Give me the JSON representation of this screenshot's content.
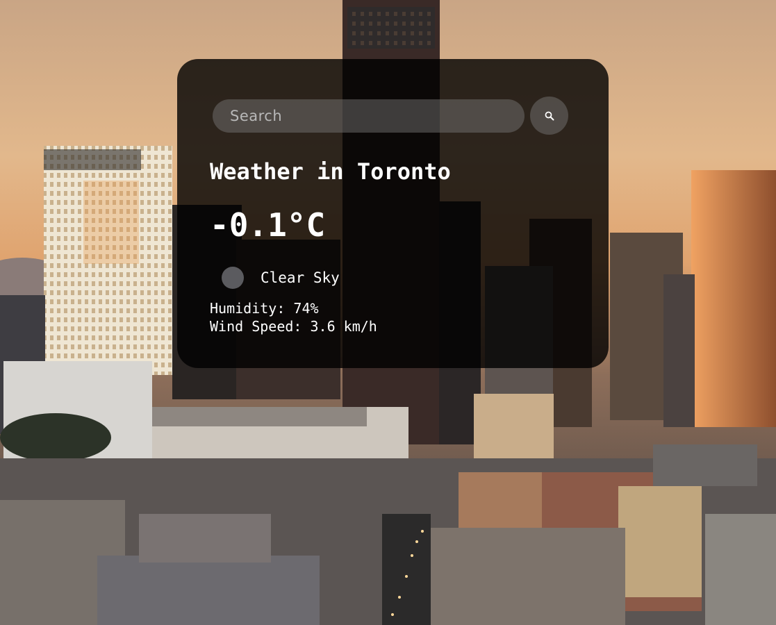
{
  "search": {
    "placeholder": "Search",
    "value": ""
  },
  "weather": {
    "city_heading": "Weather in Toronto",
    "temperature": "-0.1°C",
    "description": "Clear Sky",
    "humidity": "Humidity: 74%",
    "wind_speed": "Wind Speed: 3.6 km/h"
  },
  "icons": {
    "search_button": "search-icon",
    "weather": "weather-condition-icon"
  },
  "colors": {
    "card_background": "#000000cc",
    "control_background": "#7c7c7c73",
    "text": "#ffffff",
    "placeholder": "#b8b8b8"
  }
}
